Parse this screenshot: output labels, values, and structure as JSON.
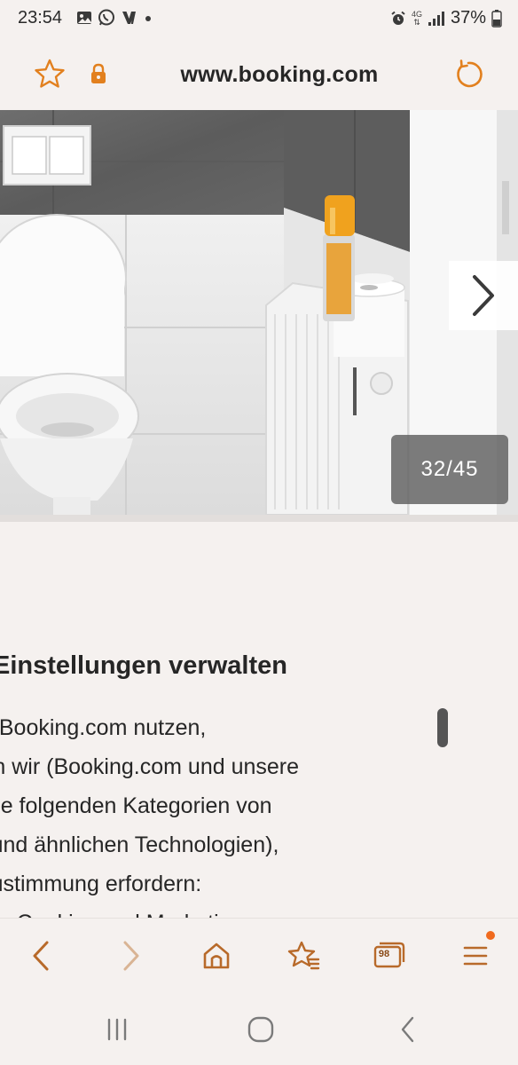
{
  "status_bar": {
    "time": "23:54",
    "network": "4G",
    "battery": "37%",
    "icons": [
      "gallery-icon",
      "whatsapp-icon",
      "v-app-icon",
      "dot-icon",
      "alarm-icon",
      "signal-icon",
      "battery-icon"
    ]
  },
  "url_bar": {
    "url": "www.booking.com",
    "icons": [
      "bookmark-star-icon",
      "lock-icon",
      "reload-icon"
    ],
    "accent_color": "#e2801e"
  },
  "gallery": {
    "counter": "32/45",
    "next_icon": "chevron-right-icon"
  },
  "content": {
    "heading": "kie-Einstellungen verwalten",
    "paragraph_lines": [
      "Wenn Sie Booking.com nutzen,",
      "verwenden wir (Booking.com und unsere",
      "Partner) die folgenden Kategorien von",
      "Cookies (und ähnlichen Technologien),",
      "die Ihre Zustimmung erfordern:",
      "Statistische Cookies und Marketing"
    ]
  },
  "toolbar": {
    "tab_count": "98",
    "icons": [
      "back-icon",
      "forward-icon",
      "home-icon",
      "bookmarks-icon",
      "tabs-icon",
      "menu-icon"
    ],
    "notification_color": "#f06a1e"
  },
  "system_nav": {
    "icons": [
      "recent-apps-icon",
      "home-circle-icon",
      "system-back-icon"
    ]
  }
}
